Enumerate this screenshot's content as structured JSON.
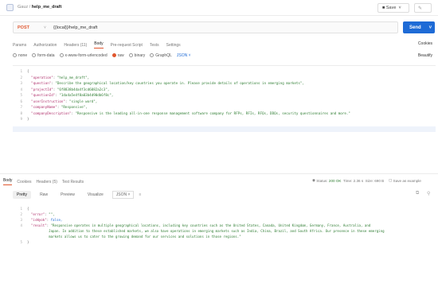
{
  "topbar": {
    "breadcrumb_parent": "Gauz",
    "breadcrumb_sep": "/",
    "request_name": "help_me_draft",
    "save_label": "Save"
  },
  "request": {
    "method": "POST",
    "url": "{{local}}/help_me_draft",
    "send_label": "Send"
  },
  "req_tabs": [
    "Params",
    "Authorization",
    "Headers (11)",
    "Body",
    "Pre-request Script",
    "Tests",
    "Settings"
  ],
  "req_active_tab": "Body",
  "cookies_label": "Cookies",
  "body_types": [
    "none",
    "form-data",
    "x-www-form-urlencoded",
    "raw",
    "binary",
    "GraphQL"
  ],
  "body_type_selected": "raw",
  "body_format": "JSON",
  "beautify_label": "Beautify",
  "request_body": [
    {
      "n": "1",
      "text": "{"
    },
    {
      "n": "2",
      "key": "\"operation\"",
      "val": "\"help_me_draft\","
    },
    {
      "n": "3",
      "key": "\"question\"",
      "val": "\"Describe the geographical location/key countries you operate in. Please provide details of operations in emerging markets\","
    },
    {
      "n": "4",
      "key": "\"projectId\"",
      "val": "\"6f8838b4da4f3cd6082a2c3\","
    },
    {
      "n": "5",
      "key": "\"questionId\"",
      "val": "\"1da4a5e4f8a03b4d90db6f8c\","
    },
    {
      "n": "6",
      "key": "\"userInstruction\"",
      "val": "\"single word\","
    },
    {
      "n": "7",
      "key": "\"companyName\"",
      "val": "\"Responsive\","
    },
    {
      "n": "8",
      "key": "\"companyDescription\"",
      "val": "\"Responsive is the leading all-in-one response management software company for RFPs, RFIs, RFQs, DDQs, security questionnaires and more.\""
    },
    {
      "n": "9",
      "text": "}"
    }
  ],
  "resp_tabs": [
    "Body",
    "Cookies",
    "Headers (5)",
    "Test Results"
  ],
  "resp_active_tab": "Body",
  "resp_status": {
    "status_label": "Status:",
    "status_value": "200 OK",
    "time_label": "Time:",
    "time_value": "2.36 s",
    "size_label": "Size:",
    "size_value": "690 B",
    "save_example": "Save as example"
  },
  "view_opts": [
    "Pretty",
    "Raw",
    "Preview",
    "Visualize"
  ],
  "view_selected": "Pretty",
  "view_format": "JSON",
  "response_body": [
    {
      "n": "1",
      "text": "{"
    },
    {
      "n": "2",
      "key": "\"error\"",
      "val": "\"\","
    },
    {
      "n": "3",
      "key": "\"isWyok\"",
      "val": "false,",
      "bool": true
    },
    {
      "n": "4",
      "key": "\"result\"",
      "val": "\"Responsive operates in multiple geographical locations, including key countries such as the United States, Canada, United Kingdom, Germany, France, Australia, and"
    },
    {
      "n": "",
      "val": "Japan. In addition to these established markets, we also have operations in emerging markets such as India, China, Brazil, and South Africa. Our presence in these emerging"
    },
    {
      "n": "",
      "val": "markets allows us to cater to the growing demand for our services and solutions in those regions.\""
    },
    {
      "n": "5",
      "text": "}"
    }
  ],
  "colors": {
    "method": "#e0572f",
    "send": "#1e6bd6",
    "json_key": "#b0306c",
    "json_string": "#2e7d32",
    "status_ok": "#2e7d32"
  }
}
